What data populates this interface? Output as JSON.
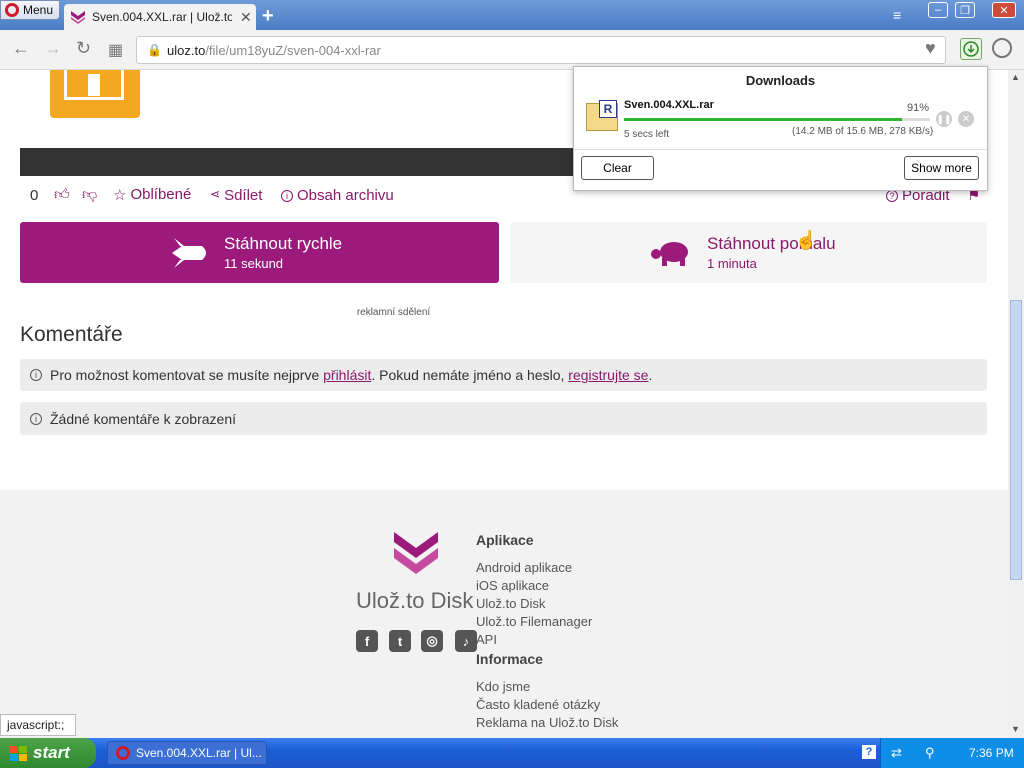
{
  "browser": {
    "menu_label": "Menu",
    "tab_title": "Sven.004.XXL.rar | Ulož.to Di",
    "url_domain": "uloz.to",
    "url_path": "/file/um18yuZ/sven-004-xxl-rar",
    "status_text": "javascript:;"
  },
  "file": {
    "likes_count": "0",
    "favorite_label": "Oblíbené",
    "share_label": "Sdílet",
    "archive_label": "Obsah archivu",
    "advise_label": "Poradit"
  },
  "download": {
    "fast_title": "Stáhnout rychle",
    "fast_sub": "11 sekund",
    "slow_title": "Stáhnout pomalu",
    "slow_sub": "1 minuta"
  },
  "ad_label": "reklamní sdělení",
  "comments": {
    "heading": "Komentáře",
    "login_notice_pre": "Pro možnost komentovat se musíte nejprve ",
    "login_link": "přihlásit",
    "login_notice_mid": ". Pokud nemáte jméno a heslo, ",
    "register_link": "registrujte se",
    "login_notice_post": ".",
    "empty_notice": "Žádné komentáře k zobrazení"
  },
  "footer": {
    "brand": "Ulož.to Disk",
    "apps_heading": "Aplikace",
    "apps": [
      "Android aplikace",
      "iOS aplikace",
      "Ulož.to Disk",
      "Ulož.to Filemanager",
      "API"
    ],
    "info_heading": "Informace",
    "info": [
      "Kdo jsme",
      "Často kladené otázky",
      "Reklama na Ulož.to Disk"
    ]
  },
  "downloads_popup": {
    "title": "Downloads",
    "filename": "Sven.004.XXL.rar",
    "percent_text": "91%",
    "progress": 0.91,
    "time_left": "5 secs left",
    "detail": "(14.2 MB of 15.6 MB, 278 KB/s)",
    "clear_label": "Clear",
    "show_more_label": "Show more"
  },
  "taskbar": {
    "start_label": "start",
    "task_label": "Sven.004.XXL.rar | Ul...",
    "clock": "7:36 PM"
  },
  "colors": {
    "accent": "#9c1a7c",
    "progress": "#2fb82f",
    "icon_orange": "#f4a820"
  }
}
